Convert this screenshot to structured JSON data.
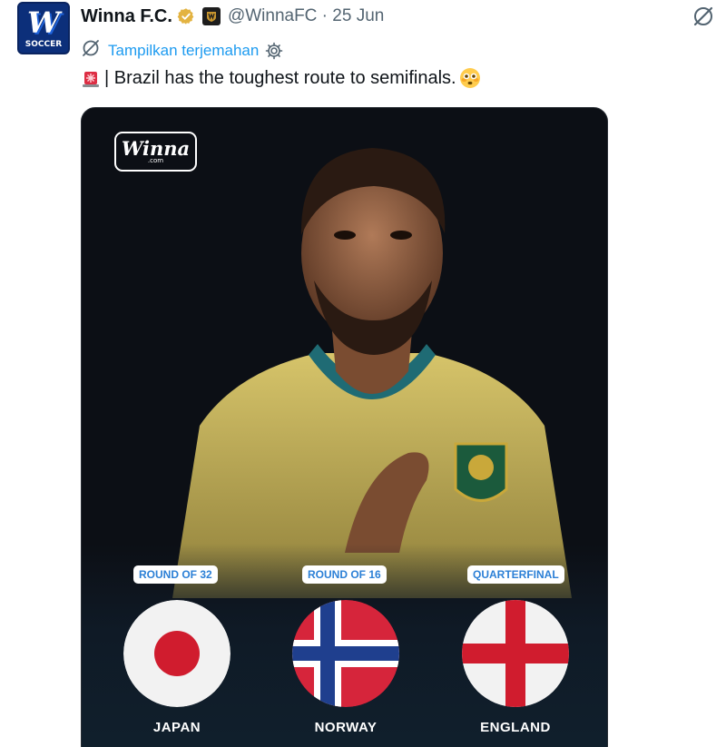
{
  "account": {
    "avatar_text": "W",
    "avatar_sub": "SOCCER",
    "name": "Winna F.C.",
    "handle_date": "@WinnaFC · 25 Jun"
  },
  "translate": {
    "label": "Tampilkan terjemahan"
  },
  "tweet": {
    "text": "| Brazil has the toughest route to semifinals."
  },
  "media": {
    "logo_main": "Winna",
    "logo_sub": ".com",
    "rounds": [
      {
        "round": "ROUND OF 32",
        "country": "JAPAN"
      },
      {
        "round": "ROUND OF 16",
        "country": "NORWAY"
      },
      {
        "round": "QUARTERFINAL",
        "country": "ENGLAND"
      }
    ]
  },
  "icons": {
    "verified": "verified-badge-icon",
    "affiliate": "affiliate-badge-icon",
    "more": "grok-icon",
    "translate": "translate-icon",
    "settings": "gear-icon",
    "siren": "siren-emoji-icon",
    "flushed": "flushed-face-emoji-icon"
  },
  "colors": {
    "link": "#1d9bf0",
    "round_label_text": "#2c80d6",
    "verified": "#e3b341"
  }
}
